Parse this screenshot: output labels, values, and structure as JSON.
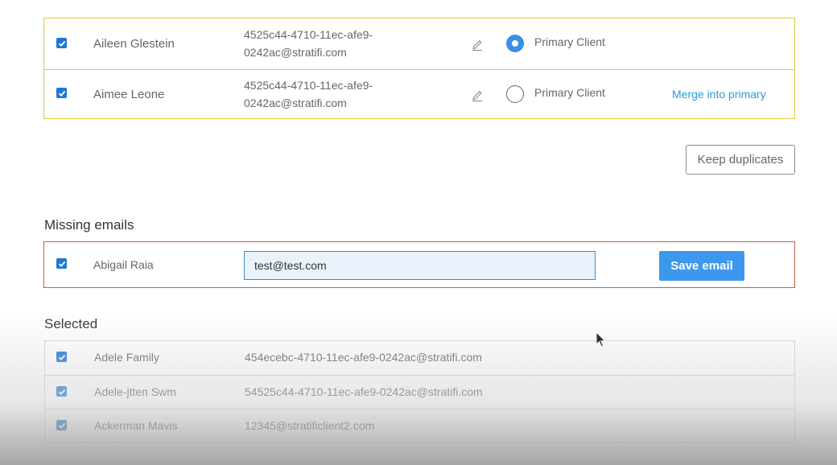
{
  "duplicates": {
    "rows": [
      {
        "name": "Aileen Glestein",
        "email_line1": "4525c44-4710-11ec-afe9-",
        "email_line2": "0242ac@stratifi.com",
        "primary_label": "Primary Client",
        "is_primary": true,
        "checked": true
      },
      {
        "name": "Aimee Leone",
        "email_line1": "4525c44-4710-11ec-afe9-",
        "email_line2": "0242ac@stratifi.com",
        "primary_label": "Primary Client",
        "is_primary": false,
        "checked": true,
        "merge_label": "Merge into primary"
      }
    ],
    "keep_label": "Keep duplicates",
    "border_color": "#e2c93a"
  },
  "missing": {
    "title": "Missing emails",
    "row": {
      "name": "Abigail Raia",
      "email_value": "test@test.com",
      "checked": true
    },
    "save_label": "Save email",
    "border_color": "#c56048"
  },
  "selected": {
    "title": "Selected",
    "rows": [
      {
        "name": "Adele Family",
        "email": "454ecebc-4710-11ec-afe9-0242ac@stratifi.com",
        "checked": true
      },
      {
        "name": "Adele-jtten Swm",
        "email": "54525c44-4710-11ec-afe9-0242ac@stratifi.com",
        "checked": true
      },
      {
        "name": "Ackerman Mavis",
        "email": "12345@stratificlient2.com",
        "checked": true
      }
    ]
  },
  "colors": {
    "accent": "#3c98ec",
    "checkbox": "#1e78d7",
    "link": "#2a9bd8"
  }
}
